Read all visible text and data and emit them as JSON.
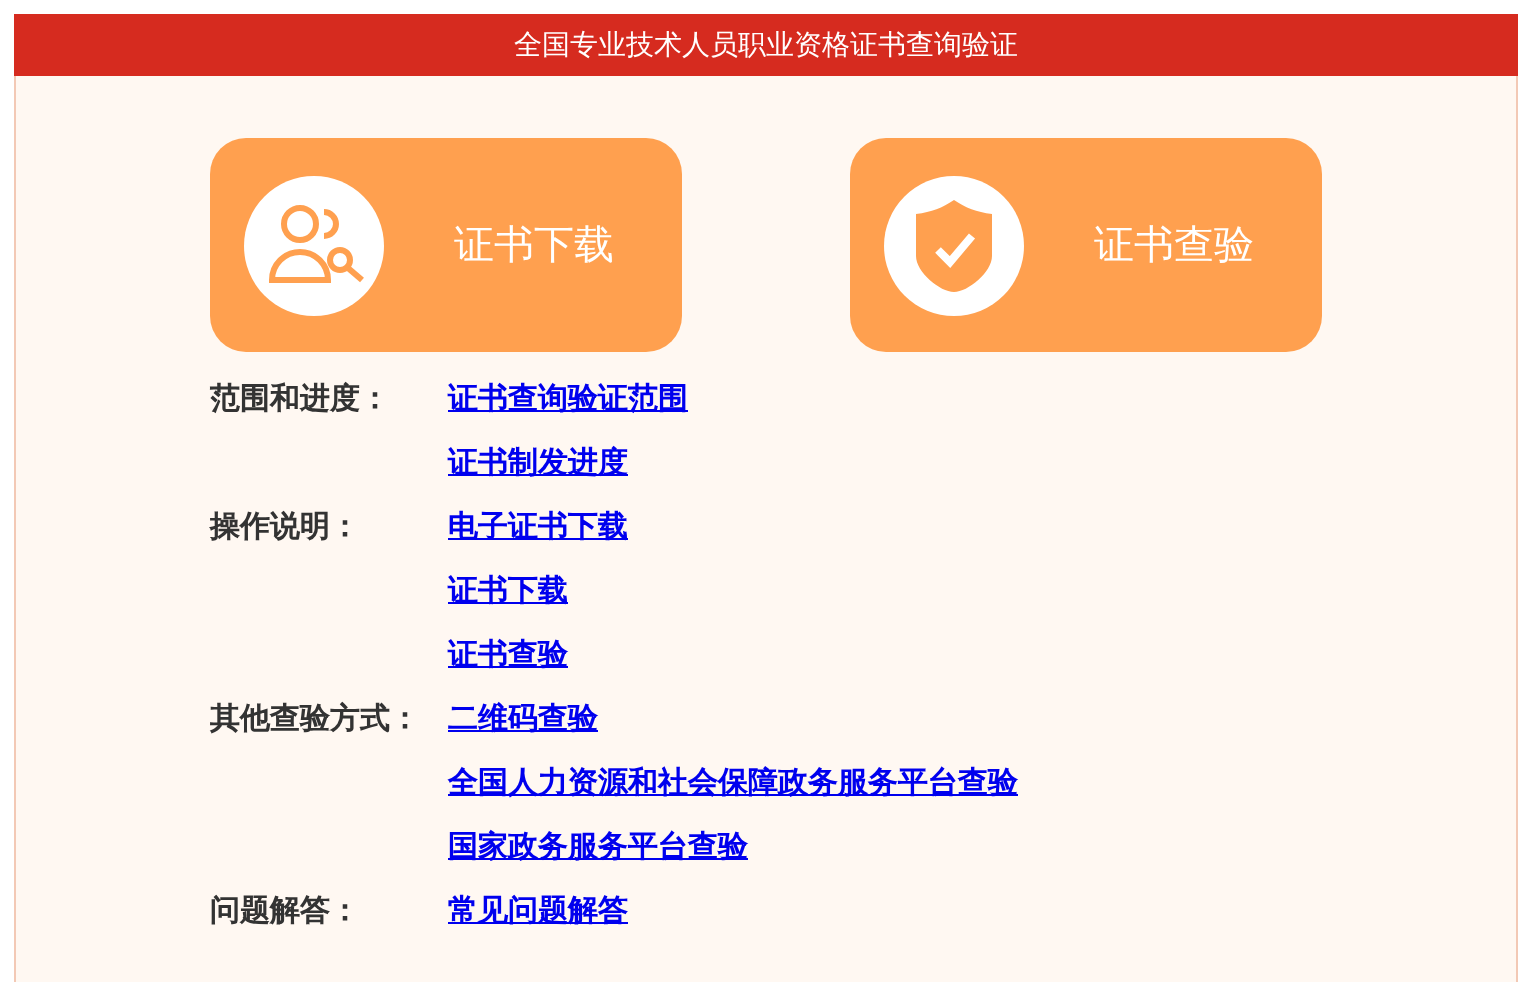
{
  "header": {
    "title": "全国专业技术人员职业资格证书查询验证"
  },
  "actions": [
    {
      "kind": "download",
      "label": "证书下载"
    },
    {
      "kind": "verify",
      "label": "证书查验"
    }
  ],
  "sections": [
    {
      "label": "范围和进度：",
      "links": [
        "证书查询验证范围",
        "证书制发进度"
      ]
    },
    {
      "label": "操作说明：",
      "links": [
        "电子证书下载",
        "证书下载",
        "证书查验"
      ]
    },
    {
      "label": "其他查验方式：",
      "links": [
        "二维码查验",
        "全国人力资源和社会保障政务服务平台查验",
        "国家政务服务平台查验"
      ]
    },
    {
      "label": "问题解答：",
      "links": [
        "常见问题解答"
      ]
    }
  ]
}
